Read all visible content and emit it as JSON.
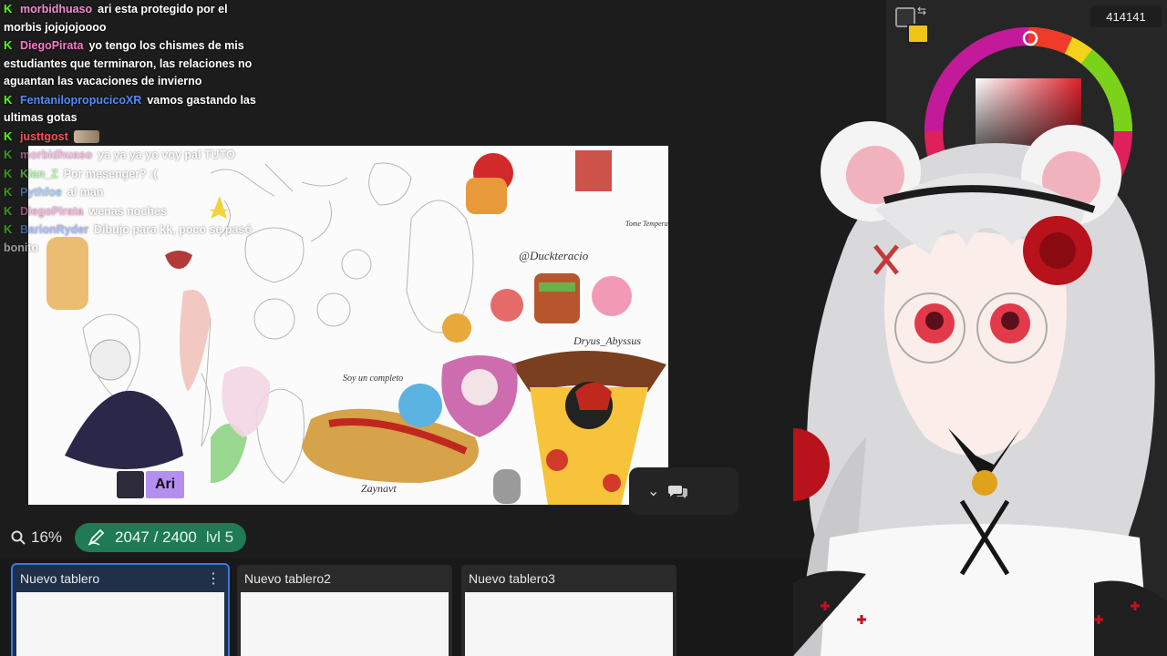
{
  "chat": {
    "messages": [
      {
        "user": "morbidhuaso",
        "color": "#f58bd2",
        "text": "ari esta protegido por el morbis jojojojoooo"
      },
      {
        "user": "DiegoPirata",
        "color": "#ff77c8",
        "text": "yo tengo los chismes de mis estudiantes que terminaron, las relaciones no aguantan las vacaciones de invierno"
      },
      {
        "user": "FentanilopropucicoXR",
        "color": "#4d8cff",
        "text": "vamos gastando las ultimas gotas"
      },
      {
        "user": "justtgost",
        "color": "#ff4f4f",
        "text": ""
      },
      {
        "user": "morbidhuaso",
        "color": "#f58bd2",
        "text": "ya ya ya yo voy pal TUTO"
      },
      {
        "user": "Klan_Z",
        "color": "#7dff6a",
        "text": "Por mesenger? :("
      },
      {
        "user": "Pythfoe",
        "color": "#5fa8ff",
        "text": "al man"
      },
      {
        "user": "DiegoPirata",
        "color": "#ff77c8",
        "text": "wenas noches"
      },
      {
        "user": "BarionRyder",
        "color": "#6a8cff",
        "text": "Dibujo para kk, poco se pasó bonito"
      }
    ]
  },
  "board": {
    "labels": {
      "duck": "@Duckteracio",
      "dryus": "Dryus_Abyssus",
      "soy": "Soy un completo",
      "zaynavt": "Zaynavt",
      "tome": "Tome Tempera"
    },
    "streamer_tag": "Ari"
  },
  "statusbar": {
    "zoom": "16%",
    "xp": "2047 / 2400",
    "level": "lvl 5"
  },
  "boards": [
    {
      "name": "Nuevo tablero",
      "active": true
    },
    {
      "name": "Nuevo tablero2",
      "active": false
    },
    {
      "name": "Nuevo tablero3",
      "active": false
    }
  ],
  "color_panel": {
    "hex": "414141",
    "primary": "#414141",
    "secondary": "#f0c419"
  },
  "icons": {
    "search": "search-icon",
    "xp": "pencil-badge-icon",
    "more": "more-vertical-icon",
    "chevron": "chevron-down-icon",
    "chat": "chat-bubbles-icon"
  }
}
